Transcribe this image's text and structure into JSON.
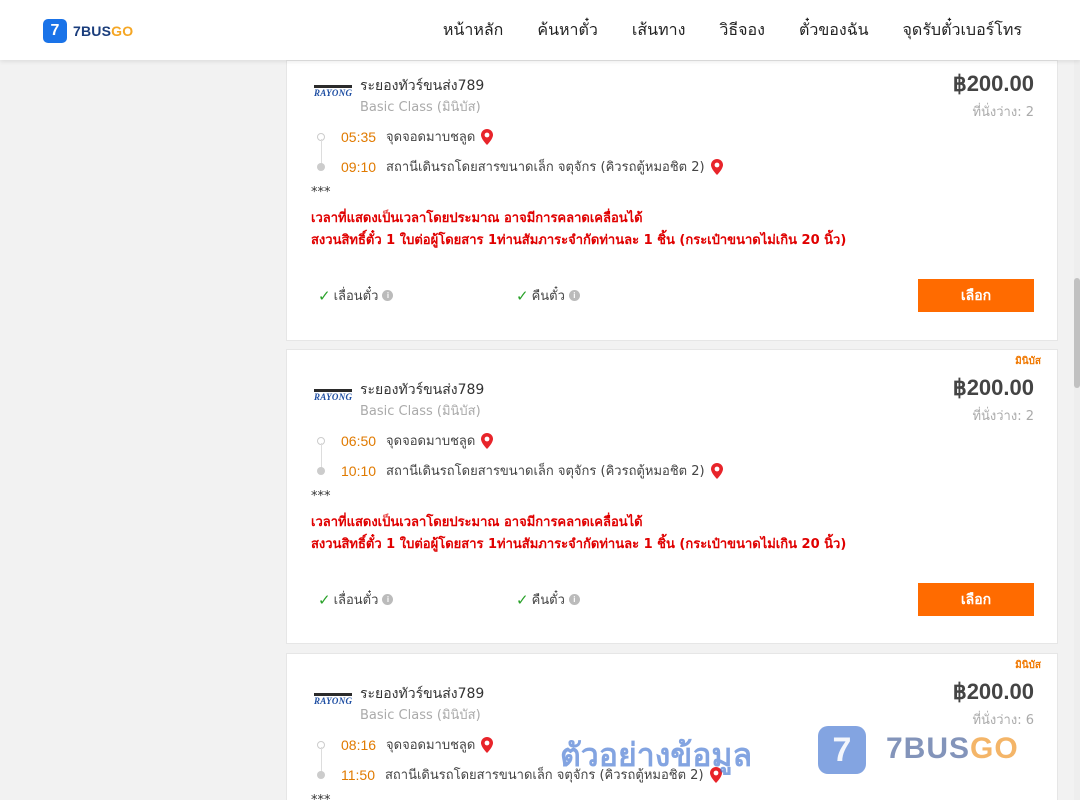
{
  "header": {
    "logo_mark": "7",
    "logo_brand_main": "7BUS",
    "logo_brand_accent": "GO",
    "nav": [
      "หน้าหลัก",
      "ค้นหาตั๋ว",
      "เส้นทาง",
      "วิธีจอง",
      "ตั๋วของฉัน",
      "จุดรับตั๋วเบอร์โทร"
    ]
  },
  "cards": [
    {
      "tag": "",
      "operator_logo": "RAYONG",
      "operator": "ระยองทัวร์ขนส่ง789",
      "class": "Basic Class (มินิบัส)",
      "price": "฿200.00",
      "seats": "ที่นั่งว่าง: 2",
      "depart_time": "05:35",
      "depart_place": "จุดจอดมาบชลูด",
      "arrive_time": "09:10",
      "arrive_place": "สถานีเดินรถโดยสารขนาดเล็ก จตุจักร (คิวรถตู้หมอชิต 2)",
      "stars": "***",
      "note1": "เวลาที่แสดงเป็นเวลาโดยประมาณ อาจมีการคลาดเคลื่อนได้",
      "note2": "สงวนสิทธิ์ตั๋ว 1 ใบต่อผู้โดยสาร 1ท่านสัมภาระจำกัดท่านละ 1 ชิ้น (กระเป๋าขนาดไม่เกิน 20 นิ้ว)",
      "feature1": "เลื่อนตั๋ว",
      "feature2": "คืนตั๋ว",
      "button": "เลือก"
    },
    {
      "tag": "มินิบัส",
      "operator_logo": "RAYONG",
      "operator": "ระยองทัวร์ขนส่ง789",
      "class": "Basic Class (มินิบัส)",
      "price": "฿200.00",
      "seats": "ที่นั่งว่าง: 2",
      "depart_time": "06:50",
      "depart_place": "จุดจอดมาบชลูด",
      "arrive_time": "10:10",
      "arrive_place": "สถานีเดินรถโดยสารขนาดเล็ก จตุจักร (คิวรถตู้หมอชิต 2)",
      "stars": "***",
      "note1": "เวลาที่แสดงเป็นเวลาโดยประมาณ อาจมีการคลาดเคลื่อนได้",
      "note2": "สงวนสิทธิ์ตั๋ว 1 ใบต่อผู้โดยสาร 1ท่านสัมภาระจำกัดท่านละ 1 ชิ้น (กระเป๋าขนาดไม่เกิน 20 นิ้ว)",
      "feature1": "เลื่อนตั๋ว",
      "feature2": "คืนตั๋ว",
      "button": "เลือก"
    },
    {
      "tag": "มินิบัส",
      "operator_logo": "RAYONG",
      "operator": "ระยองทัวร์ขนส่ง789",
      "class": "Basic Class (มินิบัส)",
      "price": "฿200.00",
      "seats": "ที่นั่งว่าง: 6",
      "depart_time": "08:16",
      "depart_place": "จุดจอดมาบชลูด",
      "arrive_time": "11:50",
      "arrive_place": "สถานีเดินรถโดยสารขนาดเล็ก จตุจักร (คิวรถตู้หมอชิต 2)",
      "stars": "***"
    }
  ],
  "watermark": {
    "text": "ตัวอย่างข้อมูล",
    "logo_mark": "7",
    "brand_main": "7BUS",
    "brand_accent": "GO"
  },
  "colors": {
    "accent": "#ff6b00",
    "time": "#e07a00",
    "warning": "#e00000",
    "check": "#2aa22a"
  }
}
